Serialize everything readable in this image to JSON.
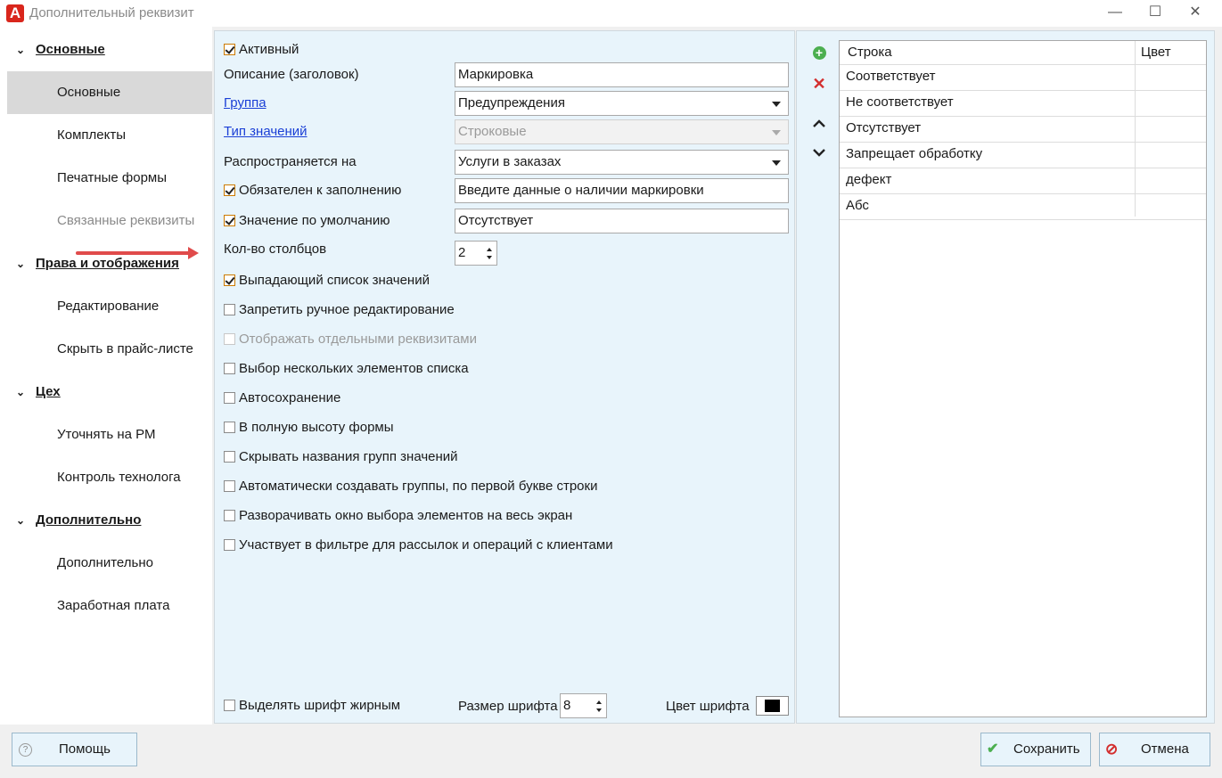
{
  "window": {
    "title": "Дополнительный реквизит",
    "logo_letter": "A",
    "minimize": "—",
    "maximize": "☐",
    "close": "✕"
  },
  "sidebar": {
    "sections": [
      {
        "label": "Основные",
        "items": [
          {
            "label": "Основные",
            "active": true
          },
          {
            "label": "Комплекты"
          },
          {
            "label": "Печатные формы"
          },
          {
            "label": "Связанные реквизиты",
            "disabled": true
          }
        ]
      },
      {
        "label": "Права и отображения",
        "items": [
          {
            "label": "Редактирование"
          },
          {
            "label": "Скрыть в прайс-листе"
          }
        ]
      },
      {
        "label": "Цех",
        "items": [
          {
            "label": "Уточнять на РМ"
          },
          {
            "label": "Контроль технолога"
          }
        ]
      },
      {
        "label": "Дополнительно",
        "items": [
          {
            "label": "Дополнительно"
          },
          {
            "label": "Заработная плата"
          }
        ]
      }
    ]
  },
  "form": {
    "active_label": "Активный",
    "description_label": "Описание (заголовок)",
    "description_value": "Маркировка",
    "group_label": "Группа",
    "group_value": "Предупреждения",
    "value_type_label": "Тип значений",
    "value_type_value": "Строковые",
    "applies_to_label": "Распространяется на",
    "applies_to_value": "Услуги в заказах",
    "required_label": "Обязателен к заполнению",
    "required_value": "Введите данные о наличии маркировки",
    "default_label": "Значение по умолчанию",
    "default_value": "Отсутствует",
    "columns_label": "Кол-во столбцов",
    "columns_value": "2",
    "options": [
      {
        "label": "Выпадающий список значений",
        "checked": true
      },
      {
        "label": "Запретить ручное редактирование",
        "checked": false
      },
      {
        "label": "Отображать отдельными реквизитами",
        "checked": false,
        "disabled": true
      },
      {
        "label": "Выбор нескольких элементов списка",
        "checked": false
      },
      {
        "label": "Автосохранение",
        "checked": false
      },
      {
        "label": "В полную высоту формы",
        "checked": false
      },
      {
        "label": "Скрывать названия групп значений",
        "checked": false
      },
      {
        "label": "Автоматически создавать группы, по первой букве строки",
        "checked": false
      },
      {
        "label": "Разворачивать окно выбора элементов на весь экран",
        "checked": false
      },
      {
        "label": "Участвует в фильтре для рассылок и операций с клиентами",
        "checked": false
      }
    ],
    "bold_label": "Выделять шрифт жирным",
    "font_size_label": "Размер шрифта",
    "font_size_value": "8",
    "font_color_label": "Цвет шрифта",
    "font_color": "#000000"
  },
  "values_grid": {
    "col_string": "Строка",
    "col_color": "Цвет",
    "rows": [
      "Соответствует",
      "Не соответствует",
      "Отсутствует",
      "Запрещает обработку",
      "дефект",
      "Абс"
    ]
  },
  "tools": {
    "add": "+",
    "delete": "✕",
    "up": "︿",
    "down": "﹀"
  },
  "buttons": {
    "help": "Помощь",
    "help_icon": "?",
    "save": "Сохранить",
    "save_icon": "✔",
    "cancel": "Отмена",
    "cancel_icon": "⊘"
  },
  "colors": {
    "accent_green": "#4caf50",
    "accent_red": "#d32f2f",
    "panel_bg": "#e8f4fb"
  }
}
